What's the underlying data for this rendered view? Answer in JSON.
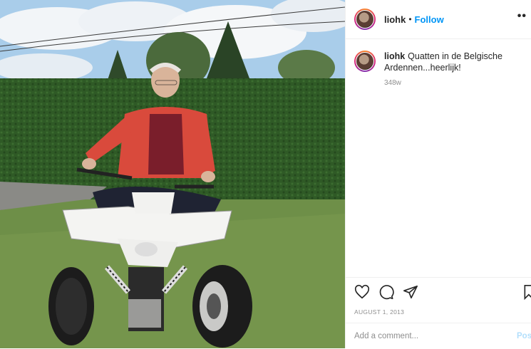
{
  "post": {
    "username": "liohk",
    "separator": "•",
    "follow_label": "Follow",
    "more_label": "••",
    "caption_text": "Quatten in de Belgische Ardennen...heerlijk!",
    "caption_age": "348w",
    "date": "AUGUST 1, 2013",
    "comment_placeholder": "Add a comment...",
    "post_label": "Post"
  },
  "photo": {
    "description_icon": "photo-image"
  },
  "icons": [
    "heart-icon",
    "comment-icon",
    "share-icon",
    "bookmark-icon",
    "more-icon"
  ],
  "colors": {
    "follow": "#0095f6",
    "text": "#262626",
    "muted": "#8e8e8e",
    "divider": "#efefef"
  }
}
